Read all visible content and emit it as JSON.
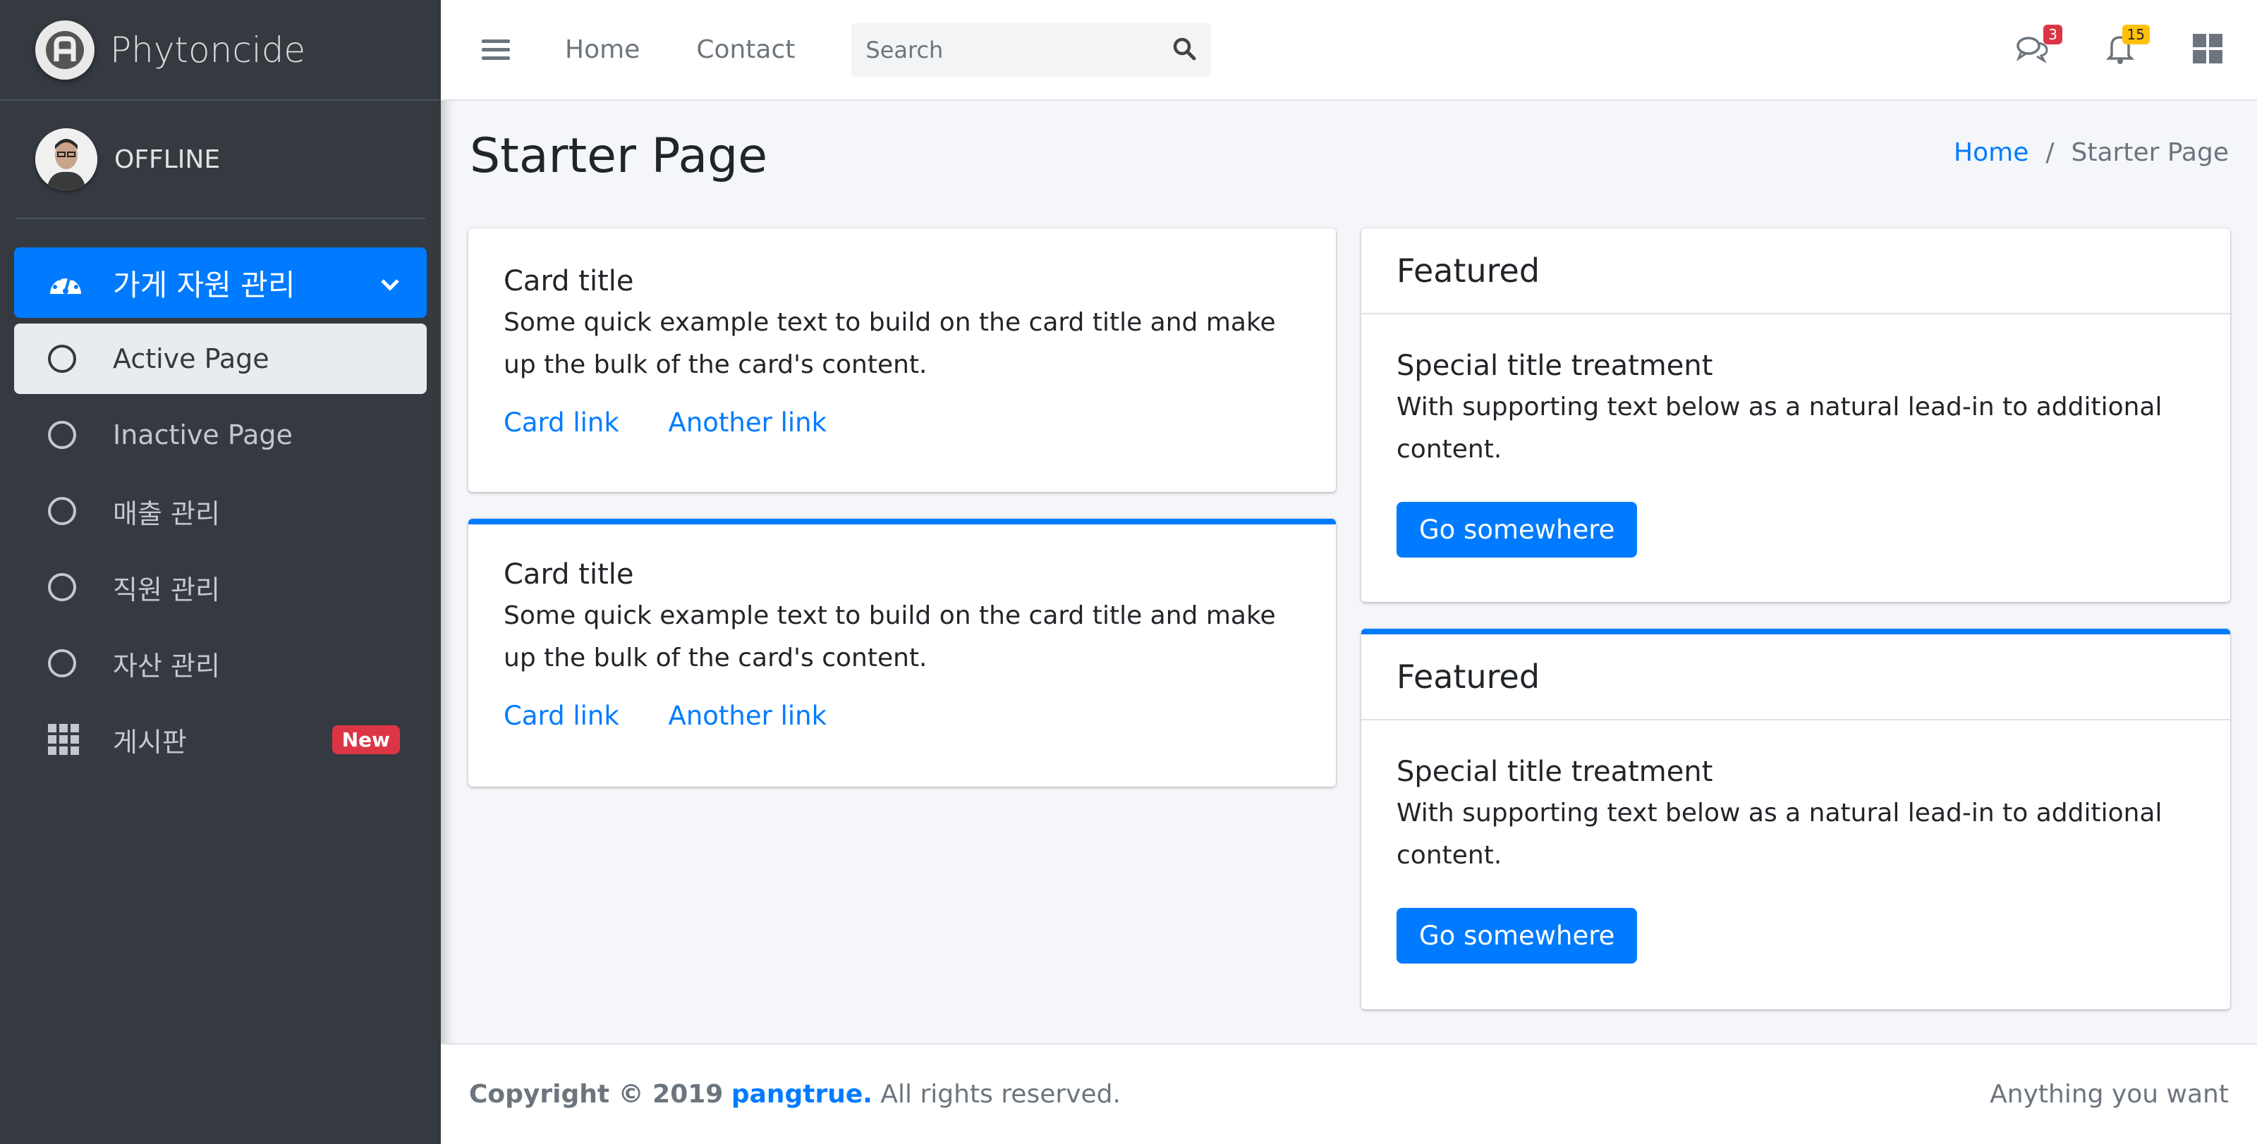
{
  "brand": {
    "name": "Phytoncide"
  },
  "user": {
    "status": "OFFLINE"
  },
  "sidebar": {
    "items": [
      {
        "label": "가게 자원 관리",
        "icon": "tachometer-icon"
      },
      {
        "label": "Active Page",
        "icon": "circle-icon"
      },
      {
        "label": "Inactive Page",
        "icon": "circle-icon"
      },
      {
        "label": "매출 관리",
        "icon": "circle-icon"
      },
      {
        "label": "직원 관리",
        "icon": "circle-icon"
      },
      {
        "label": "자산 관리",
        "icon": "circle-icon"
      },
      {
        "label": "게시판",
        "icon": "grid-icon",
        "badge": "New"
      }
    ]
  },
  "navbar": {
    "links": [
      "Home",
      "Contact"
    ],
    "search_placeholder": "Search",
    "messages_count": "3",
    "notifications_count": "15"
  },
  "content": {
    "title": "Starter Page",
    "breadcrumb": {
      "home": "Home",
      "current": "Starter Page"
    }
  },
  "left_cards": [
    {
      "title": "Card title",
      "text": "Some quick example text to build on the card title and make up the bulk of the card's content.",
      "link1": "Card link",
      "link2": "Another link"
    },
    {
      "title": "Card title",
      "text": "Some quick example text to build on the card title and make up the bulk of the card's content.",
      "link1": "Card link",
      "link2": "Another link"
    }
  ],
  "right_cards": [
    {
      "header": "Featured",
      "title": "Special title treatment",
      "text": "With supporting text below as a natural lead-in to additional content.",
      "button": "Go somewhere"
    },
    {
      "header": "Featured",
      "title": "Special title treatment",
      "text": "With supporting text below as a natural lead-in to additional content.",
      "button": "Go somewhere"
    }
  ],
  "footer": {
    "copyright": "Copyright © 2019",
    "brand": "pangtrue.",
    "rights": "All rights reserved.",
    "right_text": "Anything you want"
  },
  "colors": {
    "primary": "#007bff",
    "sidebar_bg": "#343a40",
    "danger": "#dc3545",
    "warning": "#ffc107"
  }
}
